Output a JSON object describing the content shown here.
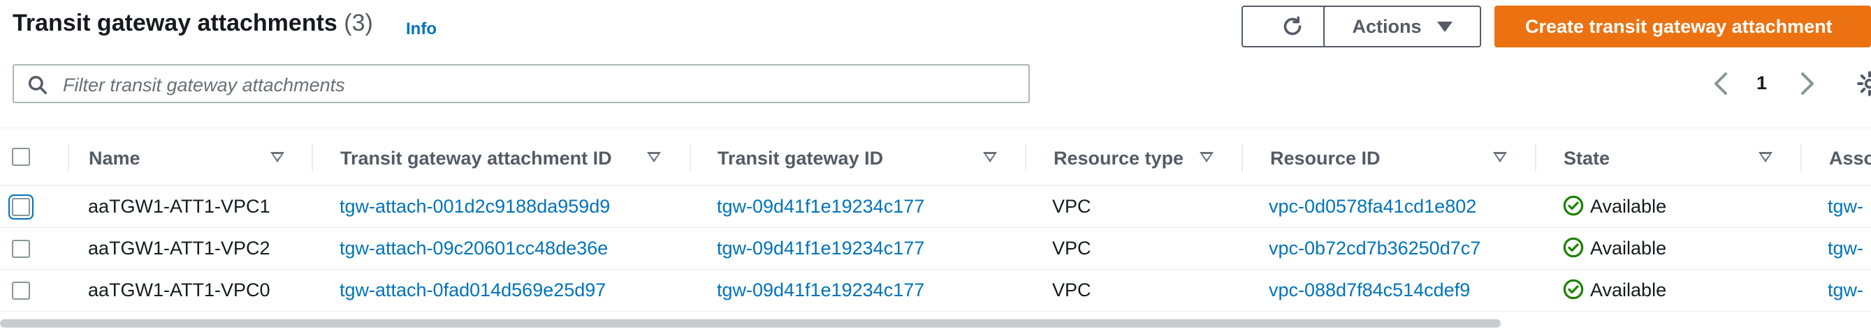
{
  "header": {
    "title": "Transit gateway attachments",
    "count": "(3)",
    "info": "Info",
    "actions_label": "Actions",
    "create_label": "Create transit gateway attachment"
  },
  "search": {
    "placeholder": "Filter transit gateway attachments"
  },
  "pagination": {
    "page": "1"
  },
  "table": {
    "columns": [
      "Name",
      "Transit gateway attachment ID",
      "Transit gateway ID",
      "Resource type",
      "Resource ID",
      "State",
      "Asso"
    ],
    "rows": [
      {
        "name": "aaTGW1-ATT1-VPC1",
        "attachment_id": "tgw-attach-001d2c9188da959d9",
        "tgw_id": "tgw-09d41f1e19234c177",
        "resource_type": "VPC",
        "resource_id": "vpc-0d0578fa41cd1e802",
        "state": "Available",
        "assoc": "tgw-"
      },
      {
        "name": "aaTGW1-ATT1-VPC2",
        "attachment_id": "tgw-attach-09c20601cc48de36e",
        "tgw_id": "tgw-09d41f1e19234c177",
        "resource_type": "VPC",
        "resource_id": "vpc-0b72cd7b36250d7c7",
        "state": "Available",
        "assoc": "tgw-"
      },
      {
        "name": "aaTGW1-ATT1-VPC0",
        "attachment_id": "tgw-attach-0fad014d569e25d97",
        "tgw_id": "tgw-09d41f1e19234c177",
        "resource_type": "VPC",
        "resource_id": "vpc-088d7f84c514cdef9",
        "state": "Available",
        "assoc": "tgw-"
      }
    ]
  },
  "colors": {
    "accent": "#ec7211",
    "link": "#0073bb",
    "success": "#1d8102"
  },
  "icons": [
    "search-icon",
    "refresh-icon",
    "caret-down-icon",
    "chevron-left-icon",
    "chevron-right-icon",
    "gear-icon",
    "sort-icon",
    "status-available-icon"
  ]
}
